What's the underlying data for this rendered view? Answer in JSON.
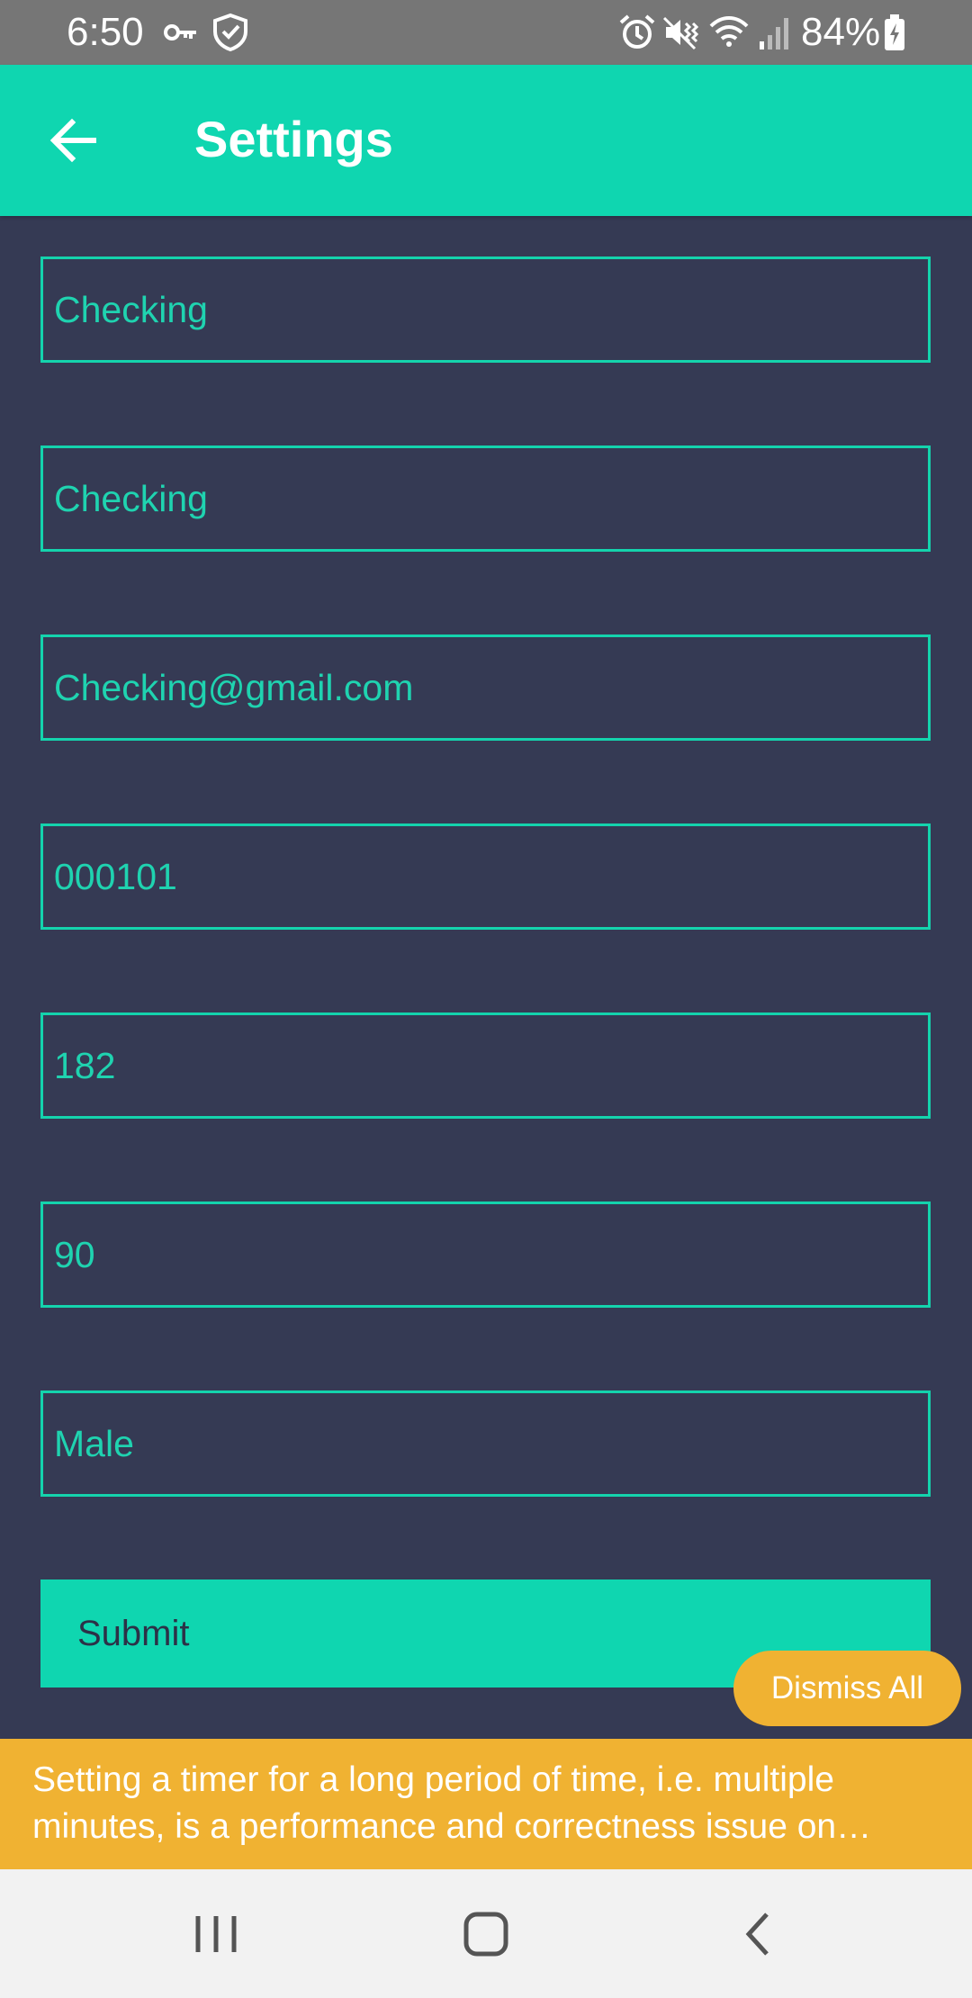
{
  "status_bar": {
    "time": "6:50",
    "battery": "84%",
    "icons": [
      "vpn-key-icon",
      "shield-check-icon",
      "alarm-icon",
      "mute-vibrate-icon",
      "wifi-icon",
      "signal-icon",
      "battery-charging-icon"
    ]
  },
  "app_bar": {
    "title": "Settings",
    "back_icon": "arrow-back-icon"
  },
  "form": {
    "fields": [
      {
        "value": "Checking"
      },
      {
        "value": "Checking"
      },
      {
        "value": "Checking@gmail.com"
      },
      {
        "value": "000101"
      },
      {
        "value": "182"
      },
      {
        "value": "90"
      },
      {
        "value": "Male"
      }
    ],
    "submit_label": "Submit"
  },
  "warning": {
    "dismiss_label": "Dismiss All",
    "message": "Setting a timer for a long period of time, i.e. multiple minutes, is a performance and correctness issue on Android as it keeps the timer module awake, and timers can only be called when the app is in the foreground."
  },
  "nav_bar": {
    "items": [
      "recent-apps-icon",
      "home-icon",
      "back-icon"
    ]
  },
  "colors": {
    "accent": "#0fd6b0",
    "background": "#353a54",
    "warning": "#f0b232",
    "status_bar": "#767676"
  }
}
